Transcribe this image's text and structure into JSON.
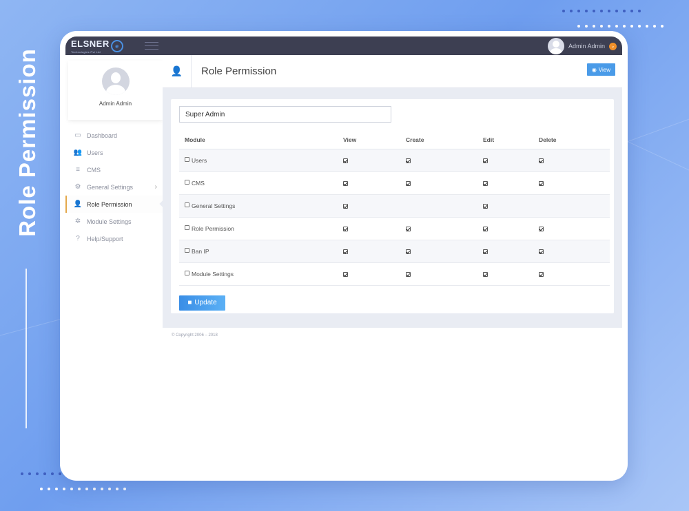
{
  "side_banner": {
    "title": "Role Permission"
  },
  "topbar": {
    "logo_text": "ELSNER",
    "logo_sub": "Technologies Pvt Ltd",
    "user_name": "Admin Admin"
  },
  "sidebar": {
    "profile_name": "Admin Admin",
    "items": [
      {
        "label": "Dashboard",
        "icon": "monitor-icon"
      },
      {
        "label": "Users",
        "icon": "users-icon"
      },
      {
        "label": "CMS",
        "icon": "list-icon"
      },
      {
        "label": "General Settings",
        "icon": "settings-icon",
        "has_chevron": true
      },
      {
        "label": "Role Permission",
        "icon": "user-check-icon",
        "active": true
      },
      {
        "label": "Module Settings",
        "icon": "gear-icon"
      },
      {
        "label": "Help/Support",
        "icon": "help-icon"
      }
    ]
  },
  "page": {
    "title": "Role Permission",
    "view_label": "View",
    "role_value": "Super Admin",
    "update_label": "Update",
    "footer": "© Copyright 2006 – 2018"
  },
  "table": {
    "headers": [
      "Module",
      "View",
      "Create",
      "Edit",
      "Delete"
    ],
    "rows": [
      {
        "module": "Users",
        "view": true,
        "create": true,
        "edit": true,
        "delete": true
      },
      {
        "module": "CMS",
        "view": true,
        "create": true,
        "edit": true,
        "delete": true
      },
      {
        "module": "General Settings",
        "view": true,
        "create": false,
        "edit": true,
        "delete": false
      },
      {
        "module": "Role Permission",
        "view": true,
        "create": true,
        "edit": true,
        "delete": true
      },
      {
        "module": "Ban IP",
        "view": true,
        "create": true,
        "edit": true,
        "delete": true
      },
      {
        "module": "Module Settings",
        "view": true,
        "create": true,
        "edit": true,
        "delete": true
      }
    ]
  }
}
